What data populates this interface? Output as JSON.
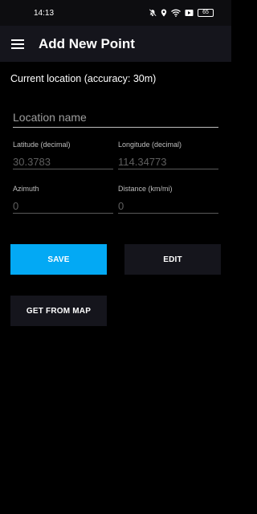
{
  "status_bar": {
    "time": "14:13",
    "icons": [
      "mute-bell-icon",
      "location-pin-icon",
      "wifi-icon",
      "media-icon"
    ],
    "battery": "65"
  },
  "toolbar": {
    "menu_icon": "hamburger-menu-icon",
    "title": "Add New Point"
  },
  "current_location": "Current location (accuracy: 30m)",
  "form": {
    "location_name": {
      "placeholder": "Location name",
      "value": ""
    },
    "latitude": {
      "label": "Latitude (decimal)",
      "placeholder": "30.3783"
    },
    "longitude": {
      "label": "Longitude (decimal)",
      "placeholder": "114.34773"
    },
    "azimuth": {
      "label": "Azimuth",
      "placeholder": "0"
    },
    "distance": {
      "label": "Distance (km/mi)",
      "placeholder": "0"
    }
  },
  "buttons": {
    "save": "SAVE",
    "edit": "EDIT",
    "get_from_map": "GET FROM MAP"
  },
  "colors": {
    "accent": "#03a9f4",
    "toolbar_bg": "#15151c",
    "background": "#000000"
  }
}
